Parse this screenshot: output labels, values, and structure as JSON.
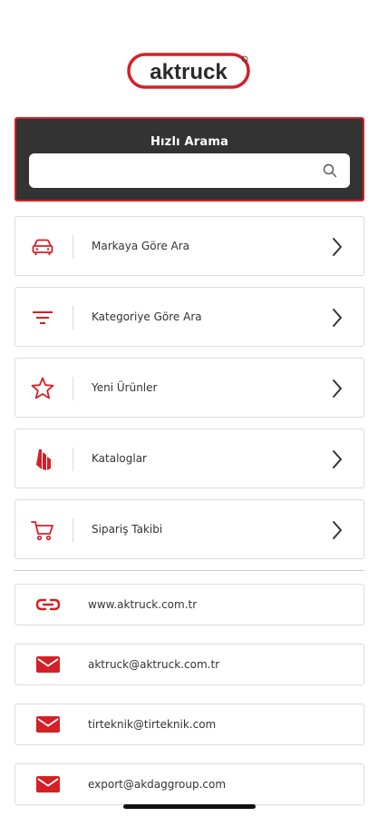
{
  "brand": {
    "logo_text": "aktruck",
    "accent": "#d42026",
    "dark": "#333333"
  },
  "search": {
    "title": "Hızlı Arama",
    "value": "",
    "placeholder": ""
  },
  "menu": [
    {
      "label": "Markaya Göre Ara",
      "icon": "car-icon"
    },
    {
      "label": "Kategoriye Göre Ara",
      "icon": "filter-icon"
    },
    {
      "label": "Yeni Ürünler",
      "icon": "star-icon"
    },
    {
      "label": "Kataloglar",
      "icon": "catalog-icon"
    },
    {
      "label": "Sipariş Takibi",
      "icon": "cart-icon"
    }
  ],
  "contacts": [
    {
      "label": "www.aktruck.com.tr",
      "icon": "link-icon"
    },
    {
      "label": "aktruck@aktruck.com.tr",
      "icon": "mail-icon"
    },
    {
      "label": "tirteknik@tirteknik.com",
      "icon": "mail-icon"
    },
    {
      "label": "export@akdaggroup.com",
      "icon": "mail-icon"
    }
  ]
}
